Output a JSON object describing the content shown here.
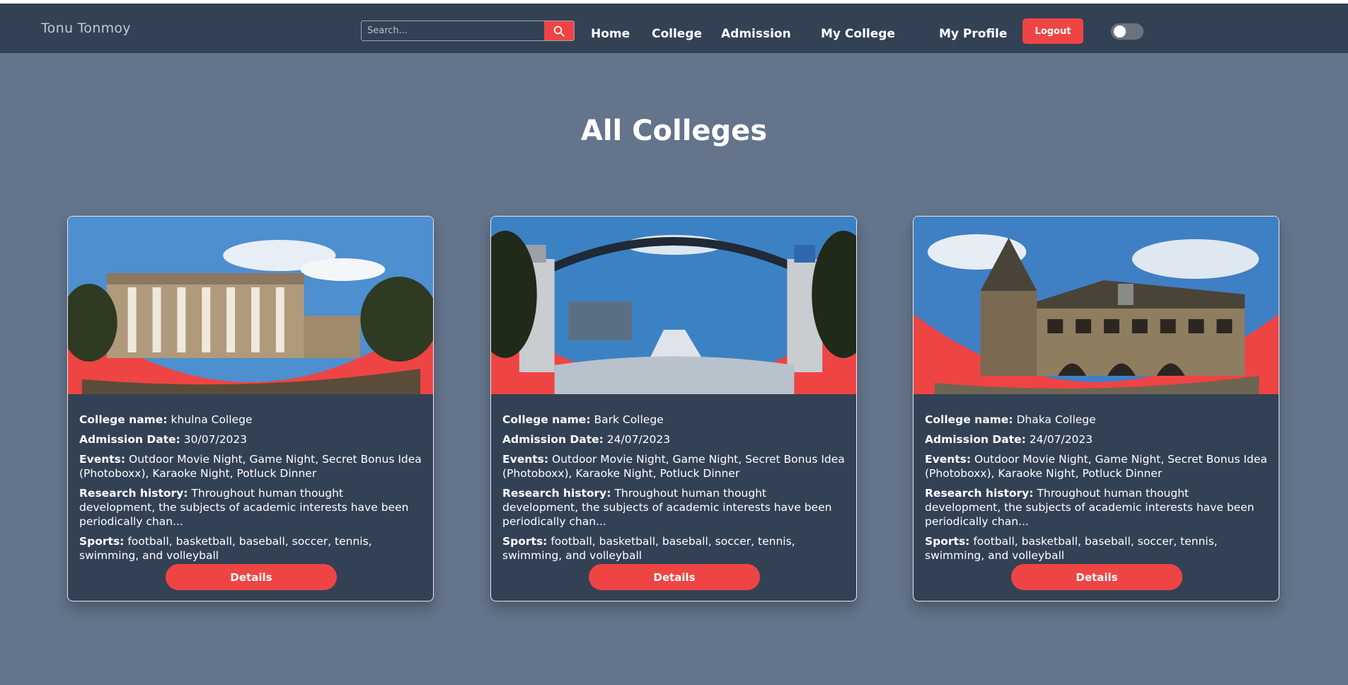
{
  "brand": "Tonu Tonmoy",
  "search": {
    "placeholder": "Search...",
    "icon": "search-icon"
  },
  "nav": {
    "home": "Home",
    "college": "College",
    "admission": "Admission",
    "my_college": "My College",
    "my_profile": "My Profile",
    "logout": "Logout"
  },
  "theme_toggle": {
    "on": false
  },
  "page_title": "All Colleges",
  "labels": {
    "name": "College name:",
    "admission": "Admission Date:",
    "events": "Events:",
    "research": "Research history:",
    "sports": "Sports:",
    "details": "Details"
  },
  "colleges": [
    {
      "image": "college-building-photo",
      "name": "khulna College",
      "admission_date": "30/07/2023",
      "events": "Outdoor Movie Night, Game Night, Secret Bonus Idea (Photoboxx), Karaoke Night, Potluck Dinner",
      "research": "Throughout human thought development, the subjects of academic interests have been periodically chan...",
      "sports": "football, basketball, baseball, soccer, tennis, swimming, and volleyball"
    },
    {
      "image": "university-gate-photo",
      "name": "Bark College",
      "admission_date": "24/07/2023",
      "events": "Outdoor Movie Night, Game Night, Secret Bonus Idea (Photoboxx), Karaoke Night, Potluck Dinner",
      "research": "Throughout human thought development, the subjects of academic interests have been periodically chan...",
      "sports": "football, basketball, baseball, soccer, tennis, swimming, and volleyball"
    },
    {
      "image": "historic-hall-photo",
      "name": "Dhaka College",
      "admission_date": "24/07/2023",
      "events": "Outdoor Movie Night, Game Night, Secret Bonus Idea (Photoboxx), Karaoke Night, Potluck Dinner",
      "research": "Throughout human thought development, the subjects of academic interests have been periodically chan...",
      "sports": "football, basketball, baseball, soccer, tennis, swimming, and volleyball"
    }
  ],
  "colors": {
    "navbar": "#334155",
    "page_bg": "#64748b",
    "accent": "#ef4444",
    "card_bg": "#334155"
  }
}
